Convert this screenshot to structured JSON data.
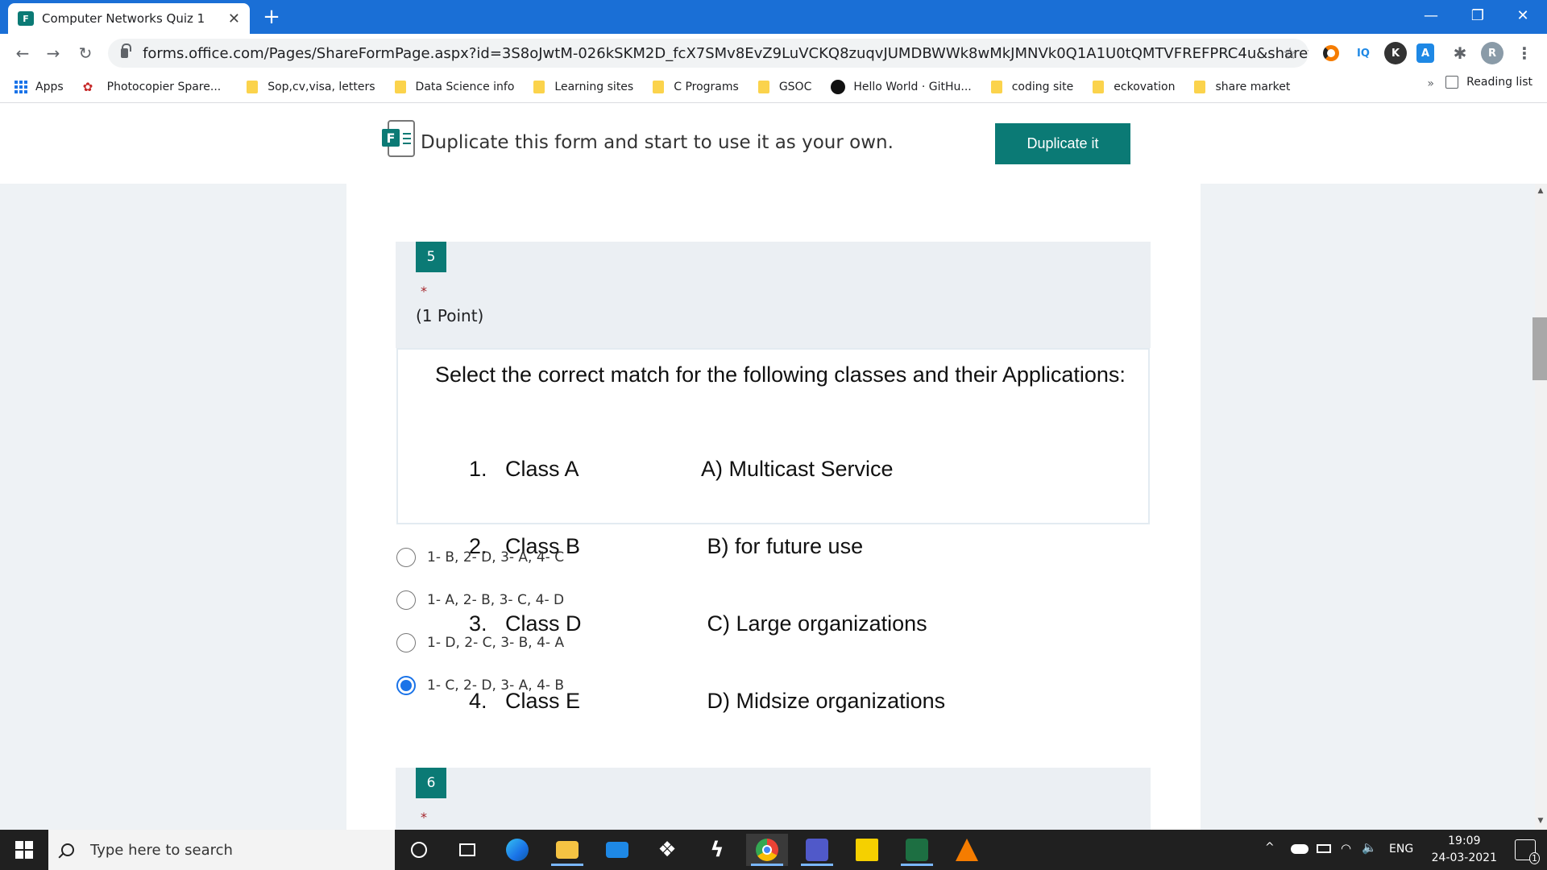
{
  "browser": {
    "tab_title": "Computer Networks Quiz 1",
    "favicon_text": "F",
    "url": "forms.office.com/Pages/ShareFormPage.aspx?id=3S8oJwtM-026kSKM2D_fcX7SMv8EvZ9LuVCKQ8zuqvJUMDBWWk8wMkJMNVk0Q1A1U0tQMTVFREFPRC4u&sharetoken=RcvvAx...",
    "profile_initial": "R",
    "ext_iq": "IQ",
    "ext_k": "K"
  },
  "bookmarks": [
    {
      "label": "Apps",
      "icon": "apps-grid-icon"
    },
    {
      "label": "Photocopier Spare...",
      "icon": "photocopier-icon"
    },
    {
      "label": "Sop,cv,visa, letters",
      "icon": "folder-icon"
    },
    {
      "label": "Data Science info",
      "icon": "folder-icon"
    },
    {
      "label": "Learning sites",
      "icon": "folder-icon"
    },
    {
      "label": "C Programs",
      "icon": "folder-icon"
    },
    {
      "label": "GSOC",
      "icon": "folder-icon"
    },
    {
      "label": "Hello World · GitHu...",
      "icon": "github-icon"
    },
    {
      "label": "coding site",
      "icon": "folder-icon"
    },
    {
      "label": "eckovation",
      "icon": "folder-icon"
    },
    {
      "label": "share market",
      "icon": "folder-icon"
    }
  ],
  "bookmarks_more": "»",
  "reading_list": "Reading list",
  "duplicate_banner": {
    "text": "Duplicate this form and start to use it as your own.",
    "button": "Duplicate it"
  },
  "question5": {
    "number": "5",
    "required_mark": "*",
    "points": "(1 Point)",
    "prompt": "Select the correct match for the following classes and their Applications:",
    "left_items": [
      "1.   Class A",
      "2.   Class B",
      "3.   Class D",
      "4.   Class E"
    ],
    "right_items": [
      "A) Multicast Service",
      " B) for future use",
      " C) Large organizations",
      " D) Midsize organizations"
    ],
    "options": [
      {
        "label": "1- B, 2- D, 3- A, 4- C",
        "selected": false
      },
      {
        "label": "1- A, 2- B, 3- C, 4- D",
        "selected": false
      },
      {
        "label": "1- D, 2- C, 3- B, 4- A",
        "selected": false
      },
      {
        "label": "1- C, 2- D, 3- A, 4- B",
        "selected": true
      }
    ]
  },
  "question6": {
    "number": "6",
    "required_mark": "*"
  },
  "taskbar": {
    "search_placeholder": "Type here to search",
    "language": "ENG",
    "time": "19:09",
    "date": "24-03-2021",
    "notification_count": "1"
  },
  "colors": {
    "accent": "#0b7a75",
    "browser_blue": "#1a6fd6",
    "radio_selected": "#1a73e8",
    "required": "#a4262c"
  }
}
